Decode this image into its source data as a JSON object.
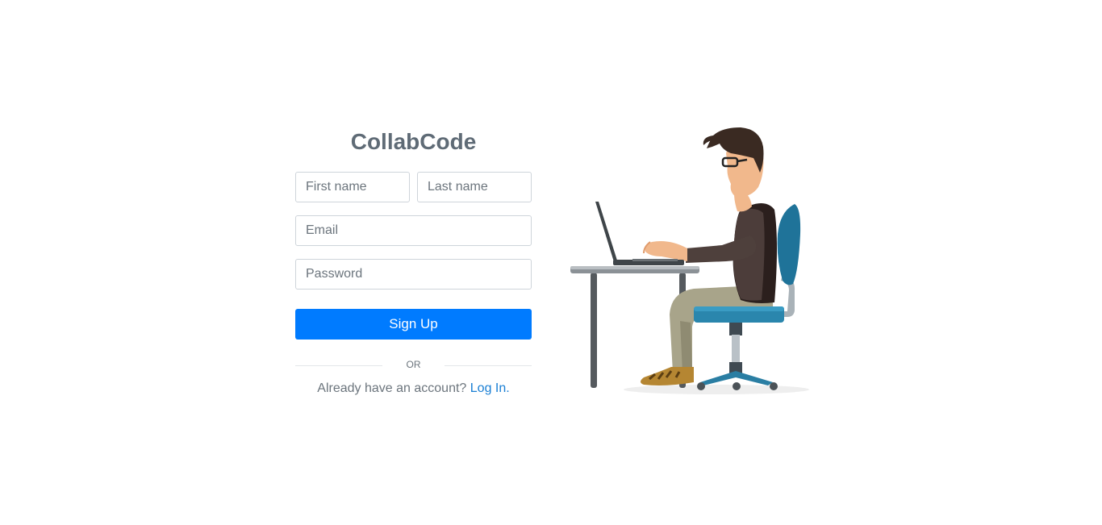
{
  "app": {
    "brand": "CollabCode"
  },
  "signup_form": {
    "first_name": {
      "placeholder": "First name",
      "value": ""
    },
    "last_name": {
      "placeholder": "Last name",
      "value": ""
    },
    "email": {
      "placeholder": "Email",
      "value": ""
    },
    "password": {
      "placeholder": "Password",
      "value": ""
    },
    "submit_label": "Sign Up",
    "divider_label": "OR",
    "login_prompt": "Already have an account?",
    "login_link_label": "Log In."
  },
  "illustration": {
    "icon": "person-at-laptop-illustration"
  },
  "colors": {
    "primary": "#007bff",
    "brand_text": "#5f6b76",
    "link": "#1a7fd4"
  }
}
